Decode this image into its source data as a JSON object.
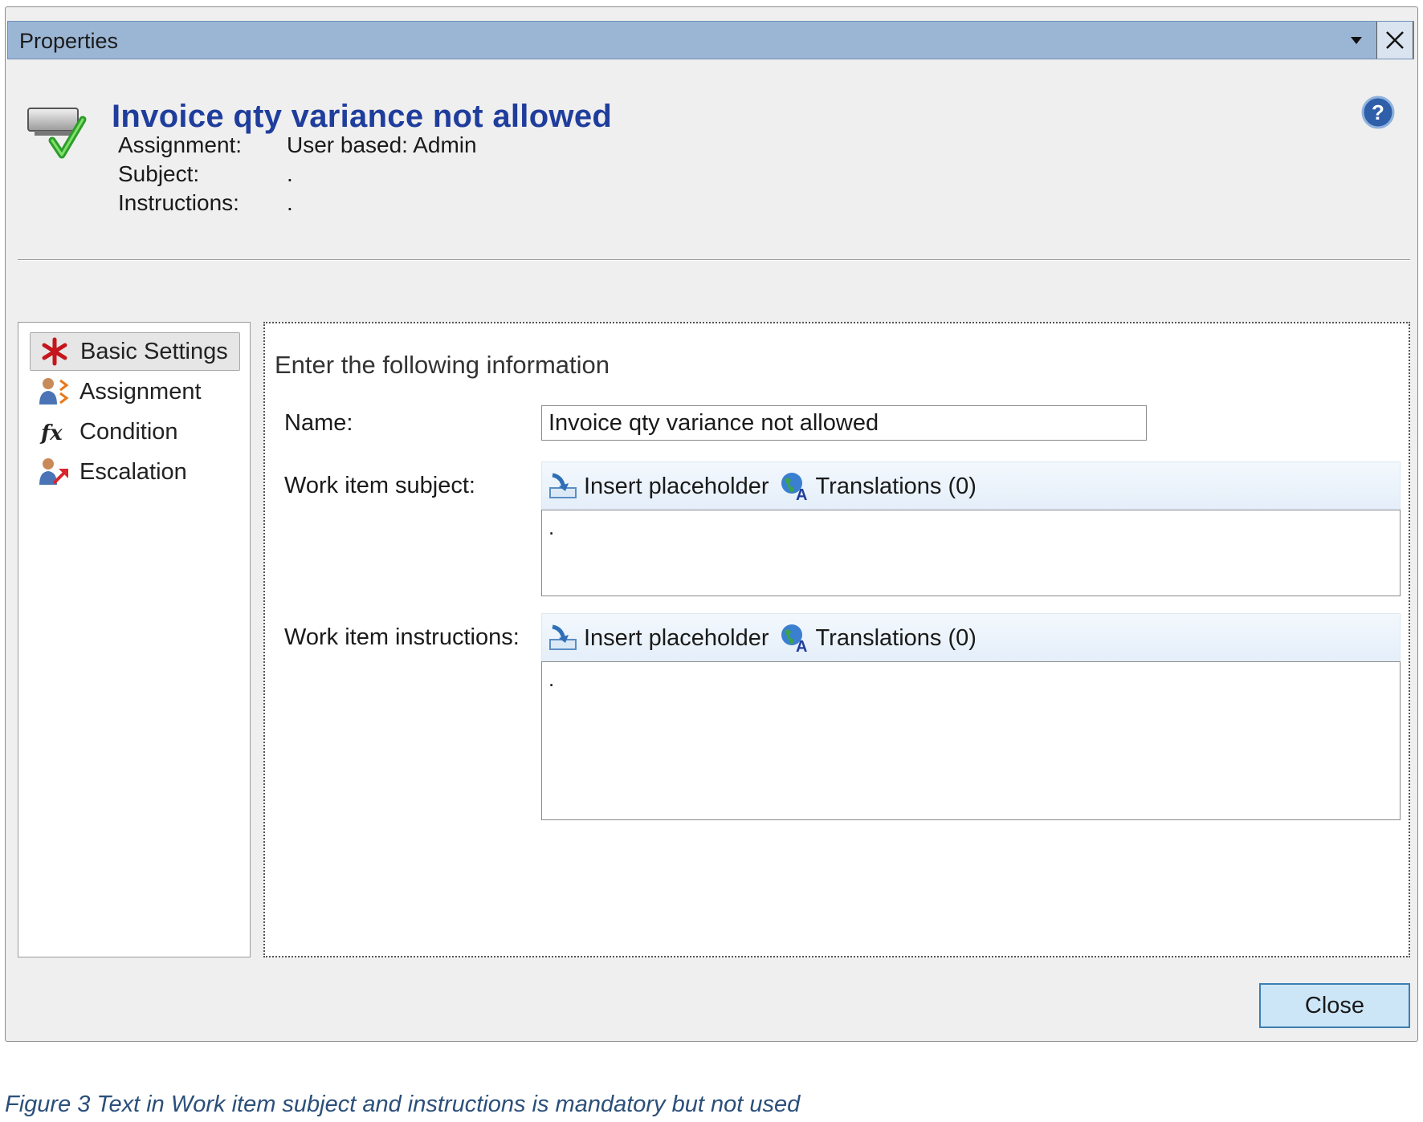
{
  "window": {
    "title": "Properties",
    "dropdown_icon": "dropdown-arrow-icon",
    "close_icon": "close-icon"
  },
  "header": {
    "icon": "approval-step-icon",
    "title": "Invoice qty variance not allowed",
    "help_icon": "help-icon",
    "rows": [
      {
        "label": "Assignment:",
        "value": "User based: Admin"
      },
      {
        "label": "Subject:",
        "value": "."
      },
      {
        "label": "Instructions:",
        "value": "."
      }
    ]
  },
  "nav": {
    "items": [
      {
        "label": "Basic Settings",
        "icon": "asterisk-icon",
        "selected": true
      },
      {
        "label": "Assignment",
        "icon": "user-assignment-icon",
        "selected": false
      },
      {
        "label": "Condition",
        "icon": "function-icon",
        "selected": false
      },
      {
        "label": "Escalation",
        "icon": "user-escalation-icon",
        "selected": false
      }
    ]
  },
  "form": {
    "section_title": "Enter the following information",
    "name_label": "Name:",
    "name_value": "Invoice qty variance not allowed",
    "subject_label": "Work item subject:",
    "subject_value": ".",
    "instructions_label": "Work item instructions:",
    "instructions_value": ".",
    "insert_placeholder_label": "Insert placeholder",
    "translations_label": "Translations (0)"
  },
  "footer": {
    "close_label": "Close"
  },
  "caption": "Figure 3 Text in Work item subject and instructions is mandatory but not used",
  "colors": {
    "titlebar": "#9bb6d5",
    "header_title": "#1f3d9c",
    "close_button": "#cde6f7",
    "caption": "#2b4f7a"
  }
}
